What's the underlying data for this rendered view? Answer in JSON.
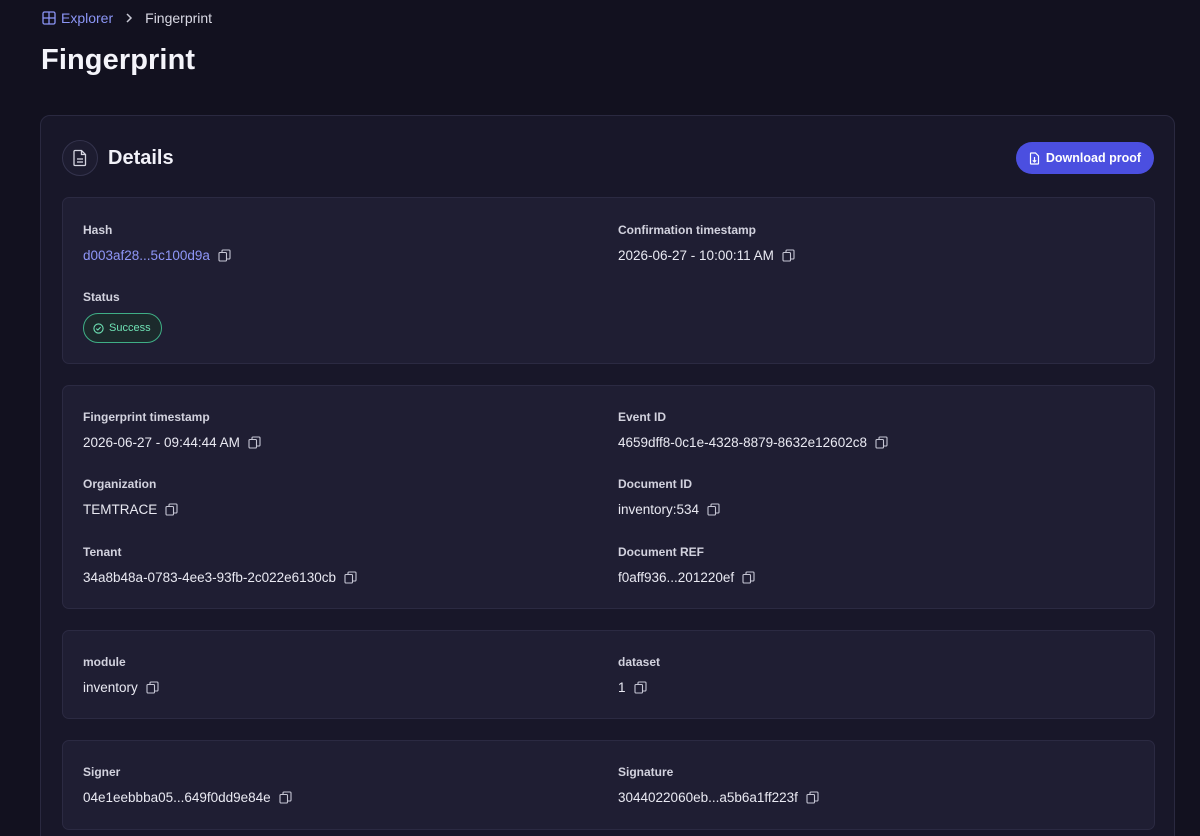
{
  "breadcrumb": {
    "root": "Explorer",
    "current": "Fingerprint"
  },
  "page_title": "Fingerprint",
  "details": {
    "title": "Details",
    "download_label": "Download proof"
  },
  "summary": {
    "hash_label": "Hash",
    "hash_value": "d003af28...5c100d9a",
    "confirmation_label": "Confirmation timestamp",
    "confirmation_value": "2026-06-27 - 10:00:11 AM",
    "status_label": "Status",
    "status_value": "Success"
  },
  "meta": {
    "fingerprint_ts_label": "Fingerprint timestamp",
    "fingerprint_ts_value": "2026-06-27 - 09:44:44 AM",
    "event_id_label": "Event ID",
    "event_id_value": "4659dff8-0c1e-4328-8879-8632e12602c8",
    "organization_label": "Organization",
    "organization_value": "TEMTRACE",
    "document_id_label": "Document ID",
    "document_id_value": "inventory:534",
    "tenant_label": "Tenant",
    "tenant_value": "34a8b48a-0783-4ee3-93fb-2c022e6130cb",
    "document_ref_label": "Document REF",
    "document_ref_value": "f0aff936...201220ef"
  },
  "attributes": {
    "module_label": "module",
    "module_value": "inventory",
    "dataset_label": "dataset",
    "dataset_value": "1"
  },
  "signing": {
    "signer_label": "Signer",
    "signer_value": "04e1eebbba05...649f0dd9e84e",
    "signature_label": "Signature",
    "signature_value": "3044022060eb...a5b6a1ff223f"
  },
  "colors": {
    "background": "#12111f",
    "accent": "#4b4fe0",
    "link": "#8e96f7",
    "success": "#6fe2b5"
  }
}
